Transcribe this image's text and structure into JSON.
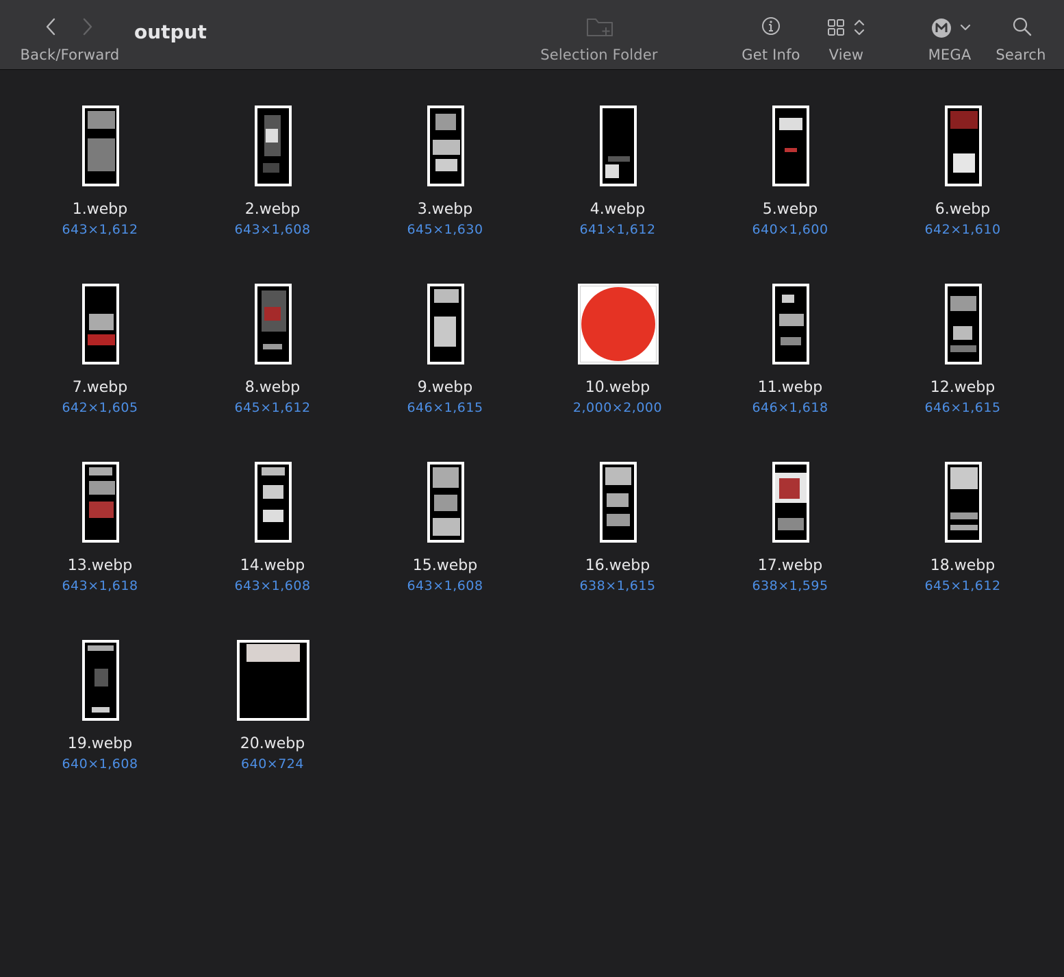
{
  "toolbar": {
    "back_forward_label": "Back/Forward",
    "title": "output",
    "selection_folder_label": "Selection Folder",
    "get_info_label": "Get Info",
    "view_label": "View",
    "mega_label": "MEGA",
    "search_label": "Search"
  },
  "files": [
    {
      "name": "1.webp",
      "dims": "643×1,612",
      "kind": "tall"
    },
    {
      "name": "2.webp",
      "dims": "643×1,608",
      "kind": "tall"
    },
    {
      "name": "3.webp",
      "dims": "645×1,630",
      "kind": "tall"
    },
    {
      "name": "4.webp",
      "dims": "641×1,612",
      "kind": "tall"
    },
    {
      "name": "5.webp",
      "dims": "640×1,600",
      "kind": "tall"
    },
    {
      "name": "6.webp",
      "dims": "642×1,610",
      "kind": "tall"
    },
    {
      "name": "7.webp",
      "dims": "642×1,605",
      "kind": "tall"
    },
    {
      "name": "8.webp",
      "dims": "645×1,612",
      "kind": "tall"
    },
    {
      "name": "9.webp",
      "dims": "646×1,615",
      "kind": "tall"
    },
    {
      "name": "10.webp",
      "dims": "2,000×2,000",
      "kind": "square"
    },
    {
      "name": "11.webp",
      "dims": "646×1,618",
      "kind": "tall"
    },
    {
      "name": "12.webp",
      "dims": "646×1,615",
      "kind": "tall"
    },
    {
      "name": "13.webp",
      "dims": "643×1,618",
      "kind": "tall"
    },
    {
      "name": "14.webp",
      "dims": "643×1,608",
      "kind": "tall"
    },
    {
      "name": "15.webp",
      "dims": "643×1,608",
      "kind": "tall"
    },
    {
      "name": "16.webp",
      "dims": "638×1,615",
      "kind": "tall"
    },
    {
      "name": "17.webp",
      "dims": "638×1,595",
      "kind": "tall"
    },
    {
      "name": "18.webp",
      "dims": "645×1,612",
      "kind": "tall"
    },
    {
      "name": "19.webp",
      "dims": "640×1,608",
      "kind": "tall"
    },
    {
      "name": "20.webp",
      "dims": "640×724",
      "kind": "short"
    }
  ],
  "colors": {
    "toolbar_bg": "#363638",
    "content_bg": "#1f1f21",
    "dims_text": "#4d8fe6",
    "red_circle": "#e53324"
  },
  "icons": {
    "back": "chevron-left-icon",
    "forward": "chevron-right-icon",
    "new_folder": "folder-plus-icon",
    "info": "info-circle-icon",
    "view": "grid-icon",
    "mega": "mega-logo-icon",
    "search": "magnifier-icon"
  }
}
